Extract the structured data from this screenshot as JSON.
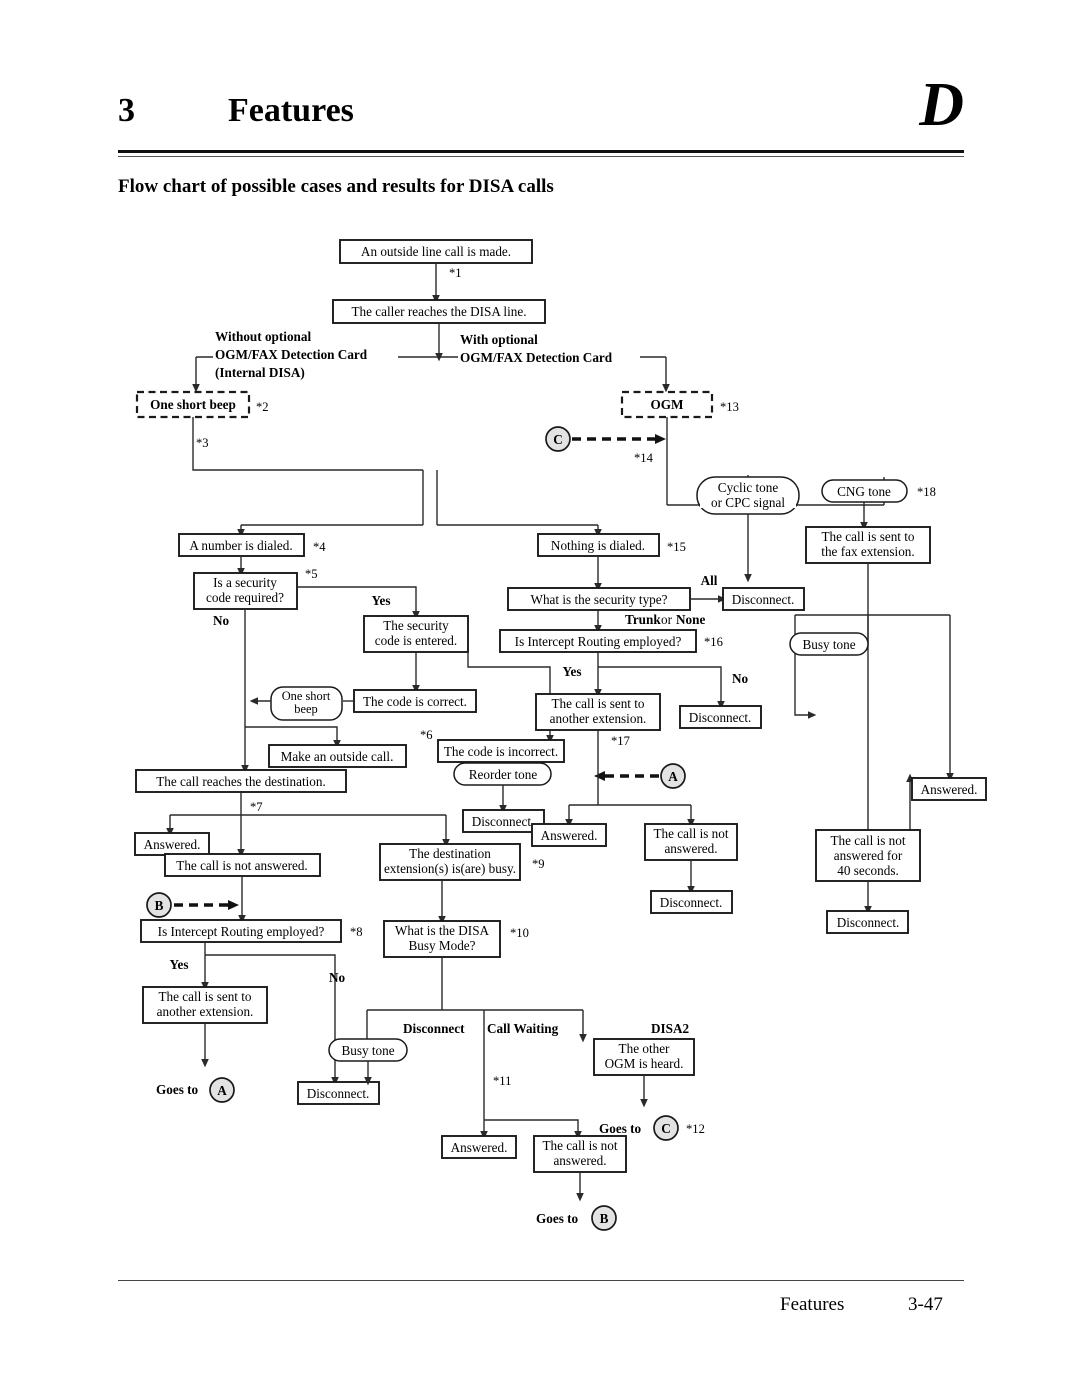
{
  "header": {
    "chapter_number": "3",
    "chapter_title": "Features",
    "corner_letter": "D",
    "subtitle": "Flow chart of possible cases and results for DISA calls"
  },
  "footer": {
    "label": "Features",
    "page": "3-47"
  },
  "chart_data": {
    "type": "diagram",
    "title": "Flow chart of possible cases and results for DISA calls",
    "nodes": [
      {
        "id": "n1",
        "label": "An outside line call is made.",
        "shape": "rect"
      },
      {
        "id": "n2",
        "label": "The caller reaches the DISA line.",
        "shape": "rect"
      },
      {
        "id": "n3",
        "label": "One short beep",
        "shape": "dashed-rect",
        "ref": "*2"
      },
      {
        "id": "n4",
        "label": "OGM",
        "shape": "dashed-rect",
        "ref": "*13"
      },
      {
        "id": "n5",
        "label": "A number is dialed.",
        "shape": "rect",
        "ref": "*4"
      },
      {
        "id": "n6",
        "label": "Is a security code required?",
        "shape": "rect",
        "ref": "*5"
      },
      {
        "id": "n7",
        "label": "The security code is entered.",
        "shape": "rect"
      },
      {
        "id": "n8",
        "label": "The code is correct.",
        "shape": "rect"
      },
      {
        "id": "n9",
        "label": "One short beep",
        "shape": "rounded"
      },
      {
        "id": "n10",
        "label": "Make an outside call.",
        "shape": "rect",
        "ref": "*6"
      },
      {
        "id": "n11",
        "label": "The code is incorrect.",
        "shape": "rect"
      },
      {
        "id": "n12",
        "label": "Reorder tone",
        "shape": "rounded"
      },
      {
        "id": "n13",
        "label": "Disconnect.",
        "shape": "rect"
      },
      {
        "id": "n14",
        "label": "The call reaches the destination.",
        "shape": "rect",
        "ref": "*7"
      },
      {
        "id": "n15",
        "label": "Answered.",
        "shape": "rect"
      },
      {
        "id": "n16",
        "label": "The call is not answered.",
        "shape": "rect"
      },
      {
        "id": "n17",
        "label": "Is Intercept Routing employed?",
        "shape": "rect",
        "ref": "*8"
      },
      {
        "id": "n18",
        "label": "The call is sent to another extension.",
        "shape": "rect"
      },
      {
        "id": "n19",
        "label": "Goes to",
        "shape": "goto",
        "target": "A"
      },
      {
        "id": "n20",
        "label": "Disconnect.",
        "shape": "rect"
      },
      {
        "id": "n21",
        "label": "The destination extension(s) is(are) busy.",
        "shape": "rect",
        "ref": "*9"
      },
      {
        "id": "n22",
        "label": "What is the DISA Busy Mode?",
        "shape": "rect",
        "ref": "*10"
      },
      {
        "id": "n23",
        "label": "Busy tone",
        "shape": "rounded"
      },
      {
        "id": "n24",
        "label": "Answered.",
        "shape": "rect"
      },
      {
        "id": "n25",
        "label": "The call is not answered.",
        "shape": "rect"
      },
      {
        "id": "n26",
        "label": "Goes to",
        "shape": "goto",
        "target": "B"
      },
      {
        "id": "n27",
        "label": "The other OGM is heard.",
        "shape": "rect"
      },
      {
        "id": "n28",
        "label": "Goes to",
        "shape": "goto",
        "target": "C",
        "ref": "*12"
      },
      {
        "id": "n29",
        "label": "Nothing is dialed.",
        "shape": "rect",
        "ref": "*15"
      },
      {
        "id": "n30",
        "label": "What is the security type?",
        "shape": "rect"
      },
      {
        "id": "n31",
        "label": "Disconnect.",
        "shape": "rect"
      },
      {
        "id": "n32",
        "label": "Is Intercept Routing employed?",
        "shape": "rect",
        "ref": "*16"
      },
      {
        "id": "n33",
        "label": "The call is sent to another extension.",
        "shape": "rect",
        "ref": "*17"
      },
      {
        "id": "n34",
        "label": "Disconnect.",
        "shape": "rect"
      },
      {
        "id": "n35",
        "label": "Answered.",
        "shape": "rect"
      },
      {
        "id": "n36",
        "label": "The call is not answered.",
        "shape": "rect"
      },
      {
        "id": "n37",
        "label": "Disconnect.",
        "shape": "rect"
      },
      {
        "id": "n38",
        "label": "Cyclic tone or CPC signal",
        "shape": "rounded"
      },
      {
        "id": "n39",
        "label": "CNG tone",
        "shape": "rounded",
        "ref": "*18"
      },
      {
        "id": "n40",
        "label": "The call is sent to the fax extension.",
        "shape": "rect"
      },
      {
        "id": "n41",
        "label": "Busy tone",
        "shape": "rounded"
      },
      {
        "id": "n42",
        "label": "Answered.",
        "shape": "rect"
      },
      {
        "id": "n43",
        "label": "The call is not answered for 40 seconds.",
        "shape": "rect"
      },
      {
        "id": "n44",
        "label": "Disconnect.",
        "shape": "rect"
      }
    ],
    "branch_labels": [
      "Without optional",
      "OGM/FAX Detection Card",
      "(Internal DISA)",
      "With optional",
      "OGM/FAX Detection Card",
      "Yes",
      "No",
      "All",
      "Trunk",
      "or",
      "None",
      "Disconnect",
      "Call Waiting",
      "DISA2"
    ],
    "reference_marks": [
      "*1",
      "*2",
      "*3",
      "*4",
      "*5",
      "*6",
      "*7",
      "*8",
      "*9",
      "*10",
      "*11",
      "*12",
      "*13",
      "*14",
      "*15",
      "*16",
      "*17",
      "*18"
    ],
    "connectors": [
      "A",
      "B",
      "C"
    ]
  },
  "diagram": {
    "n1": "An outside line call is made.",
    "n2": "The caller reaches the DISA line.",
    "ref1": "*1",
    "without_1": "Without optional",
    "without_2": "OGM/FAX Detection Card",
    "without_3": "(Internal DISA)",
    "with_1": "With optional",
    "with_2": "OGM/FAX Detection Card",
    "beep": "One short beep",
    "ref2": "*2",
    "ref3": "*3",
    "ogm": "OGM",
    "ref13": "*13",
    "ref14": "*14",
    "conn_c": "C",
    "n5": "A number is dialed.",
    "ref4": "*4",
    "n6a": "Is a security",
    "n6b": "code required?",
    "ref5": "*5",
    "yes": "Yes",
    "no": "No",
    "n7a": "The security",
    "n7b": "code is entered.",
    "n9a": "One short",
    "n9b": "beep",
    "n8": "The code is correct.",
    "n10": "Make an outside call.",
    "ref6": "*6",
    "n11": "The code is incorrect.",
    "n12": "Reorder tone",
    "n13": "Disconnect.",
    "n14": "The call reaches the destination.",
    "ref7": "*7",
    "n15": "Answered.",
    "n16": "The call is not answered.",
    "conn_b": "B",
    "n17": "Is Intercept Routing employed?",
    "ref8": "*8",
    "n18a": "The call is sent to",
    "n18b": "another extension.",
    "goes_to": "Goes to",
    "conn_a": "A",
    "n20": "Disconnect.",
    "n21a": "The destination",
    "n21b": "extension(s) is(are) busy.",
    "ref9": "*9",
    "n22a": "What is the DISA",
    "n22b": "Busy Mode?",
    "ref10": "*10",
    "lbl_disconnect": "Disconnect",
    "lbl_callwaiting": "Call Waiting",
    "lbl_disa2": "DISA2",
    "n23": "Busy tone",
    "ref11": "*11",
    "n24": "Answered.",
    "n25a": "The call is not",
    "n25b": "answered.",
    "n27a": "The other",
    "n27b": "OGM is heard.",
    "ref12": "*12",
    "n29": "Nothing is dialed.",
    "ref15": "*15",
    "n30": "What is the security type?",
    "lbl_all": "All",
    "lbl_trunk": "Trunk",
    "lbl_or": "or",
    "lbl_none": "None",
    "n31": "Disconnect.",
    "n32": "Is Intercept Routing employed?",
    "ref16": "*16",
    "n33a": "The call is sent to",
    "n33b": "another extension.",
    "ref17": "*17",
    "n34": "Disconnect.",
    "n35": "Answered.",
    "n36a": "The call is not",
    "n36b": "answered.",
    "n37": "Disconnect.",
    "n38a": "Cyclic tone",
    "n38b": "or CPC signal",
    "n39": "CNG tone",
    "ref18": "*18",
    "n40a": "The call is sent to",
    "n40b": "the fax extension.",
    "n41": "Busy tone",
    "n42": "Answered.",
    "n43a": "The call is not",
    "n43b": "answered for",
    "n43c": "40 seconds.",
    "n44": "Disconnect."
  }
}
